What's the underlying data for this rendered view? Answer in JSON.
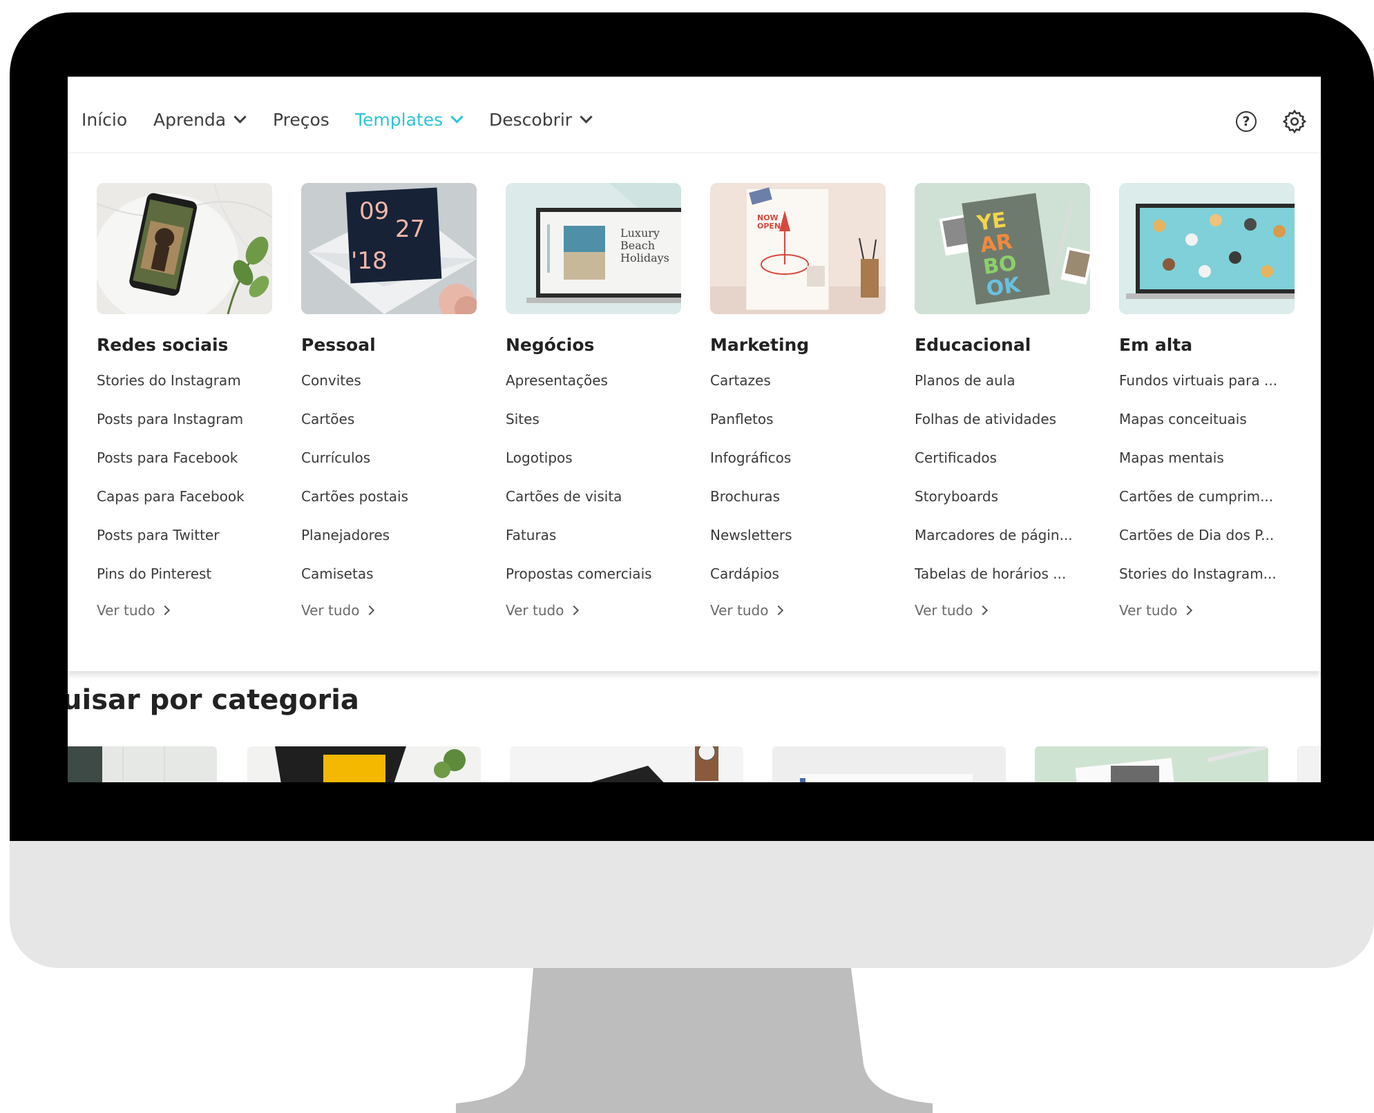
{
  "nav": {
    "items": [
      {
        "label": "Início"
      },
      {
        "label": "Aprenda"
      },
      {
        "label": "Preços"
      },
      {
        "label": "Templates"
      },
      {
        "label": "Descobrir"
      }
    ],
    "help_symbol": "?",
    "icons": [
      "help-circle-icon",
      "gear-icon"
    ],
    "accent_color": "#2ec4d6"
  },
  "dropdown": {
    "columns": [
      {
        "title": "Redes sociais",
        "image": "phone-stories-thumbnail",
        "links": [
          "Stories do Instagram",
          "Posts para Instagram",
          "Posts para Facebook",
          "Capas para Facebook",
          "Posts para Twitter",
          "Pins do Pinterest"
        ],
        "see_all": "Ver tudo"
      },
      {
        "title": "Pessoal",
        "image": "invitation-card-thumbnail",
        "thumb_text": [
          "09",
          "27",
          "'18"
        ],
        "links": [
          "Convites",
          "Cartões",
          "Currículos",
          "Cartões postais",
          "Planejadores",
          "Camisetas"
        ],
        "see_all": "Ver tudo"
      },
      {
        "title": "Negócios",
        "image": "laptop-presentation-thumbnail",
        "thumb_text": [
          "Luxury",
          "Beach",
          "Holidays"
        ],
        "links": [
          "Apresentações",
          "Sites",
          "Logotipos",
          "Cartões de visita",
          "Faturas",
          "Propostas comerciais"
        ],
        "see_all": "Ver tudo"
      },
      {
        "title": "Marketing",
        "image": "pizza-poster-thumbnail",
        "thumb_text": [
          "NOW",
          "OPEN!"
        ],
        "links": [
          "Cartazes",
          "Panfletos",
          "Infográficos",
          "Brochuras",
          "Newsletters",
          "Cardápios"
        ],
        "see_all": "Ver tudo"
      },
      {
        "title": "Educacional",
        "image": "yearbook-thumbnail",
        "thumb_text": [
          "YE",
          "AR",
          "BO",
          "OK"
        ],
        "links": [
          "Planos de aula",
          "Folhas de atividades",
          "Certificados",
          "Storyboards",
          "Marcadores de págin...",
          "Tabelas de horários ..."
        ],
        "see_all": "Ver tudo"
      },
      {
        "title": "Em alta",
        "image": "laptop-dogs-thumbnail",
        "links": [
          "Fundos virtuais para ...",
          "Mapas conceituais",
          "Mapas mentais",
          "Cartões de cumprim...",
          "Cartões de Dia dos P...",
          "Stories do Instagram..."
        ],
        "see_all": "Ver tudo"
      }
    ]
  },
  "section": {
    "title": "uisar por categoria"
  }
}
